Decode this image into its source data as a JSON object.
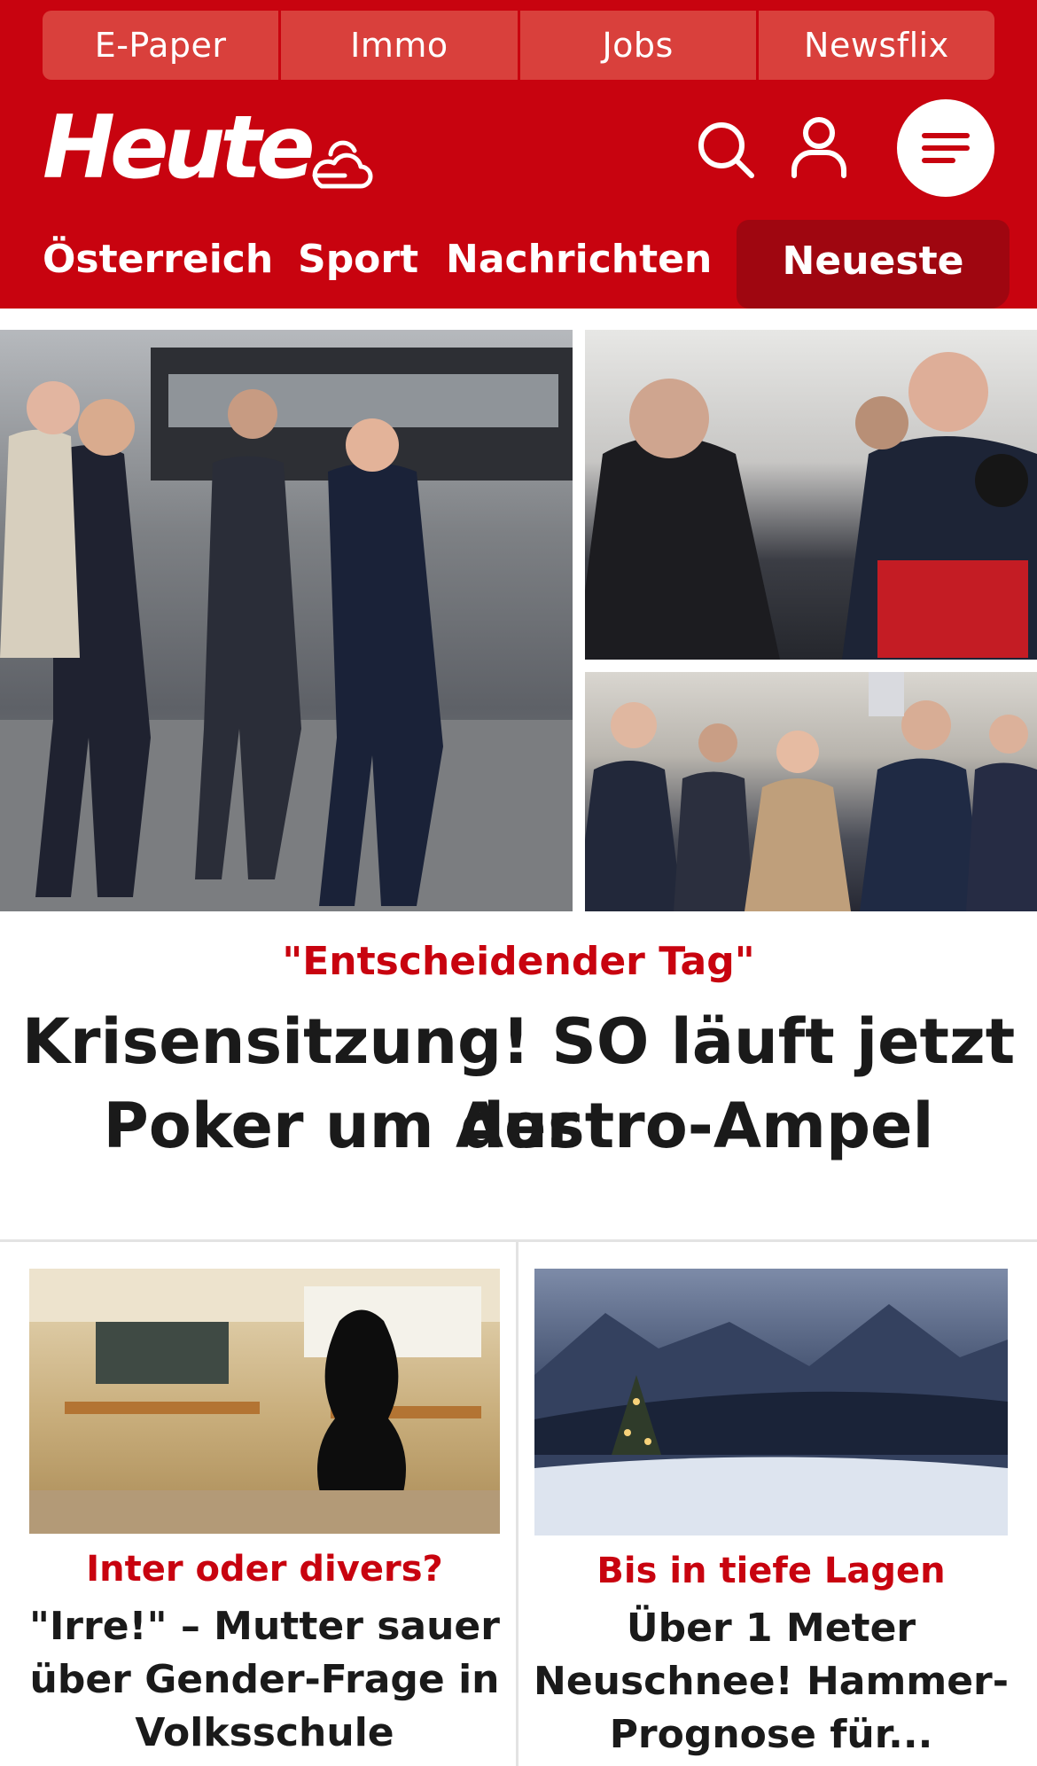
{
  "topbar": {
    "links": [
      "E-Paper",
      "Immo",
      "Jobs",
      "Newsflix"
    ]
  },
  "header": {
    "logo": "Heute",
    "weather_icon": "cloud-sun-icon",
    "search_icon": "search-icon",
    "account_icon": "user-icon",
    "menu_icon": "hamburger-menu-icon"
  },
  "nav": {
    "items": [
      "Österreich",
      "Sport",
      "Nachrichten"
    ],
    "active": "Neueste"
  },
  "hero": {
    "kicker": "\"Entscheidender Tag\"",
    "headline_line1": "Krisensitzung! SO läuft jetzt der",
    "headline_line2": "Poker um Austro-Ampel",
    "images": [
      "politicians-walking-photo",
      "politicians-press-microphone-photo",
      "politicians-group-walking-photo"
    ]
  },
  "teasers": [
    {
      "kicker": "Inter oder divers?",
      "title_lines": [
        "\"Irre!\" – Mutter sauer",
        "über Gender-Frage in",
        "Volksschule"
      ],
      "image": "classroom-silhouette-photo"
    },
    {
      "kicker": "Bis in tiefe Lagen",
      "title_lines": [
        "Über 1 Meter",
        "Neuschnee! Hammer-",
        "Prognose für..."
      ],
      "image": "snowy-mountain-village-photo"
    }
  ],
  "colors": {
    "brand_red": "#c8030f",
    "active_tab": "#9f0610",
    "text_dark": "#1a1a1a"
  }
}
